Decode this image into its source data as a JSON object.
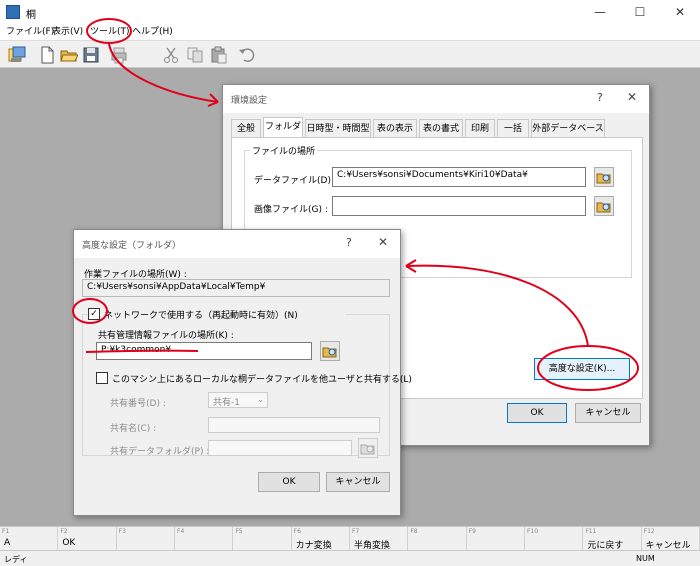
{
  "window": {
    "title": "桐",
    "controls": [
      "—",
      "☐",
      "✕"
    ]
  },
  "menu": [
    "ファイル(F)",
    "表示(V)",
    "ツール(T)",
    "ヘルプ(H)"
  ],
  "toolbar_icons": [
    "open-db-icon",
    "new-file-icon",
    "open-folder-icon",
    "save-icon",
    "print-icon",
    "cut-icon",
    "copy-icon",
    "paste-icon",
    "undo-icon"
  ],
  "env_dialog": {
    "title": "環境設定",
    "help": "?",
    "close": "✕",
    "tabs": [
      "全般",
      "フォルダ",
      "日時型・時間型",
      "表の表示",
      "表の書式",
      "印刷",
      "一括",
      "外部データベース"
    ],
    "active_tab": "フォルダ",
    "group_label": "ファイルの場所",
    "data_file_label": "データファイル(D) :",
    "data_file_value": "C:¥Users¥sonsi¥Documents¥Kiri10¥Data¥",
    "image_file_label": "画像ファイル(G) :",
    "image_file_value": "",
    "advanced_button": "高度な設定(K)...",
    "ok": "OK",
    "cancel": "キャンセル"
  },
  "adv_dialog": {
    "title": "高度な設定（フォルダ）",
    "help": "?",
    "close": "✕",
    "work_label": "作業ファイルの場所(W) :",
    "work_value": "C:¥Users¥sonsi¥AppData¥Local¥Temp¥",
    "network_check": "ネットワークで使用する（再起動時に有効）(N)",
    "network_checked": true,
    "shared_mgmt_label": "共有管理情報ファイルの場所(K) :",
    "shared_mgmt_value": "P:¥k3common¥",
    "share_local_check": "このマシン上にあるローカルな桐データファイルを他ユーザと共有する(L)",
    "share_local_checked": false,
    "share_no_label": "共有番号(D) :",
    "share_no_value": "共有-1",
    "share_name_label": "共有名(C) :",
    "share_folder_label": "共有データフォルダ(P) :",
    "ok": "OK",
    "cancel": "キャンセル"
  },
  "fkeys": [
    {
      "n": "F1",
      "v": "A"
    },
    {
      "n": "F2",
      "v": "OK"
    },
    {
      "n": "F3",
      "v": ""
    },
    {
      "n": "F4",
      "v": ""
    },
    {
      "n": "F5",
      "v": ""
    },
    {
      "n": "F6",
      "v": "カナ変換"
    },
    {
      "n": "F7",
      "v": "半角変換"
    },
    {
      "n": "F8",
      "v": ""
    },
    {
      "n": "F9",
      "v": ""
    },
    {
      "n": "F10",
      "v": ""
    },
    {
      "n": "F11",
      "v": "元に戻す"
    },
    {
      "n": "F12",
      "v": "キャンセル"
    }
  ],
  "status": {
    "left": "レディ",
    "num": "NUM"
  },
  "colors": {
    "annotation": "#e0001b",
    "workspace": "#ababab",
    "app_icon": "#2f6fb5"
  }
}
